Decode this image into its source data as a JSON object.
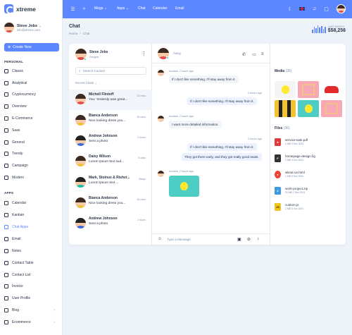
{
  "app": {
    "name": "xtreme"
  },
  "profile": {
    "name": "Steve Jobs",
    "email": "info@xtreme.com"
  },
  "sidebar": {
    "create_label": "Create New",
    "personal_title": "PERSONAL",
    "personal": [
      "Classic",
      "Analytical",
      "Cryptocurrency",
      "Overview",
      "E-Commerce",
      "Saas",
      "General",
      "Trendy",
      "Campaign",
      "Modern"
    ],
    "apps_title": "APPS",
    "apps": [
      "Calendar",
      "Kanban",
      "Chat Apps",
      "Email",
      "Notes",
      "Contact Table",
      "Contact List",
      "Invoice",
      "User Profile",
      "Blog",
      "Ecommerce"
    ]
  },
  "topbar": {
    "mega": "Mega",
    "apps": "Apps",
    "chat": "Chat",
    "calendar": "Calendar",
    "email": "Email"
  },
  "page": {
    "title": "Chat",
    "breadcrumb": [
      "Home",
      "Chat"
    ],
    "lastmonth_label": "LAST MONTH",
    "lastmonth_value": "$58,256",
    "bar_levels": [
      0.5,
      0.8,
      0.6,
      1.0,
      0.7,
      0.9,
      0.55,
      0.85
    ]
  },
  "chat": {
    "me": {
      "name": "Steve Jobs",
      "role": "Designer"
    },
    "search_placeholder": "Search Contact",
    "recent_label": "Recent Chats",
    "contacts": [
      {
        "name": "Michell Flintoff",
        "msg": "You: Yesterdy was great...",
        "time": "15 mins"
      },
      {
        "name": "Bianca Anderson",
        "msg": "Nice looking dress you...",
        "time": "30 mins"
      },
      {
        "name": "Andrew Johnson",
        "msg": "Sent a photo",
        "time": "2 hours"
      },
      {
        "name": "Daisy Wilson",
        "msg": "Lorem Ipsum text sud...",
        "time": "5 days"
      },
      {
        "name": "Mark, Stoinus & Rishvi...",
        "msg": "Lorem Ipsum text ...",
        "time": "5days"
      },
      {
        "name": "Bianca Anderson",
        "msg": "Nice looking dress you...",
        "time": "30 mins"
      },
      {
        "name": "Andrew Johnson",
        "msg": "Sent a photo",
        "time": "2 hours"
      }
    ],
    "active": {
      "status": "Away"
    },
    "messages": [
      {
        "meta": "Andrew, 2 hours ago",
        "text": "If I don't like something, I'll stay away from it."
      },
      {
        "meta": "2 hours ago",
        "text": "If I don't like something, I'll stay away from it."
      },
      {
        "meta": "Andrew, 2 hours ago",
        "text": "I want more detailed information."
      },
      {
        "meta": "2 hours ago",
        "text": "If I don't like something, I'll stay away from it."
      },
      {
        "meta": "",
        "text": "They got there early, and they got really good seats."
      },
      {
        "meta": "Andrew, 2 hours ago",
        "text": ""
      }
    ],
    "input_placeholder": "Type a Message",
    "media_title": "Media",
    "media_count": "(36)",
    "files_title": "Files",
    "files_count": "(36)",
    "files": [
      {
        "name": "service-task.pdf",
        "meta": "2 MB    2 Dec 2024",
        "color": "#e03b3b",
        "icon": "pdf-icon"
      },
      {
        "name": "homepage-design.fig",
        "meta": "3 MB    3 Dec 2024",
        "color": "#333333",
        "icon": "figma-icon"
      },
      {
        "name": "about-us.html",
        "meta": "1 MB    5 Dec 2024",
        "color": "#ea4335",
        "icon": "chrome-icon"
      },
      {
        "name": "work-project.zip",
        "meta": "20 MB    7 Dec 2024",
        "color": "#3a9be0",
        "icon": "zip-icon"
      },
      {
        "name": "custom.js",
        "meta": "2 MB    3 Dec 2024",
        "color": "#f0c419",
        "icon": "js-icon"
      }
    ]
  }
}
